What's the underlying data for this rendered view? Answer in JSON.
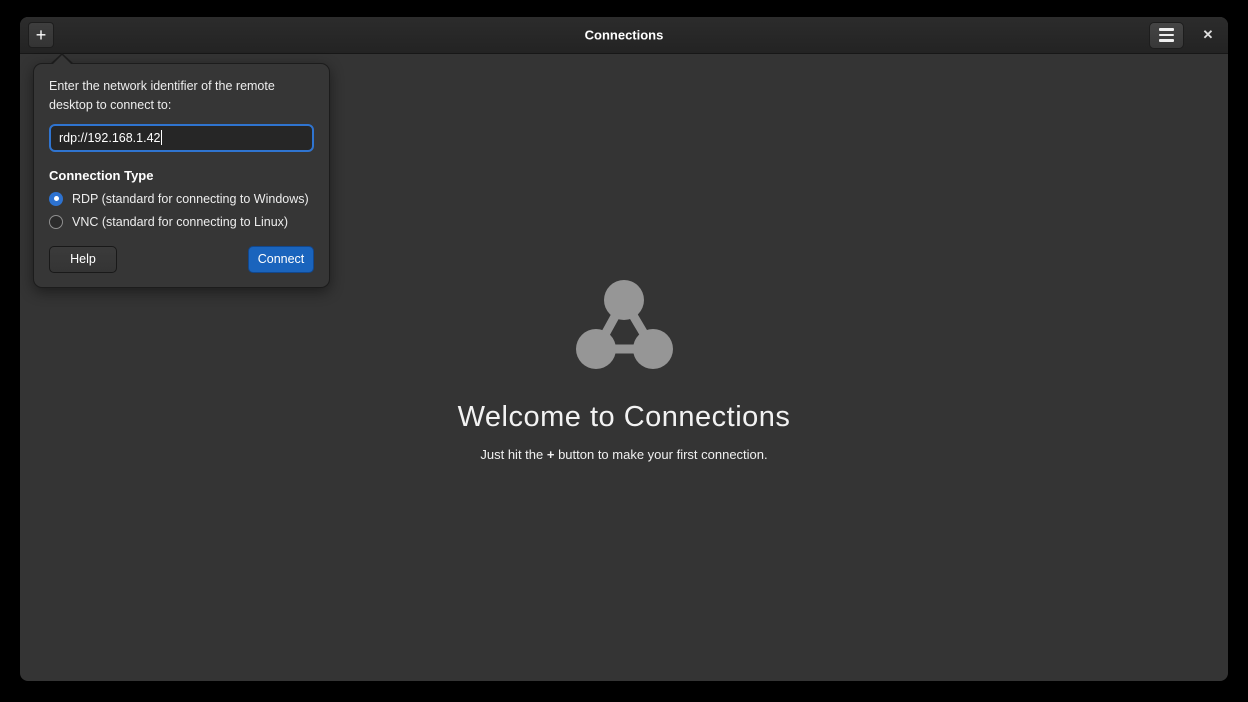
{
  "window": {
    "title": "Connections"
  },
  "titlebar": {
    "add_button_label": "+",
    "close_icon_glyph": "✕"
  },
  "popover": {
    "prompt": "Enter the network identifier of the remote desktop to connect to:",
    "address_value": "rdp://192.168.1.42",
    "connection_type_label": "Connection Type",
    "options": [
      {
        "label": "RDP (standard for connecting to Windows)",
        "selected": true
      },
      {
        "label": "VNC (standard for connecting to Linux)",
        "selected": false
      }
    ],
    "help_label": "Help",
    "connect_label": "Connect"
  },
  "main": {
    "welcome_title": "Welcome to Connections",
    "hint_prefix": "Just hit the ",
    "hint_plus": "+",
    "hint_suffix": " button to make your first connection."
  },
  "colors": {
    "accent_blue": "#1a64bd",
    "radio_selected_blue": "#2d72d0",
    "input_focus_border": "#2f74d0",
    "window_bg": "#343434",
    "titlebar_bg": "#262626",
    "icon_gray": "#969696"
  }
}
